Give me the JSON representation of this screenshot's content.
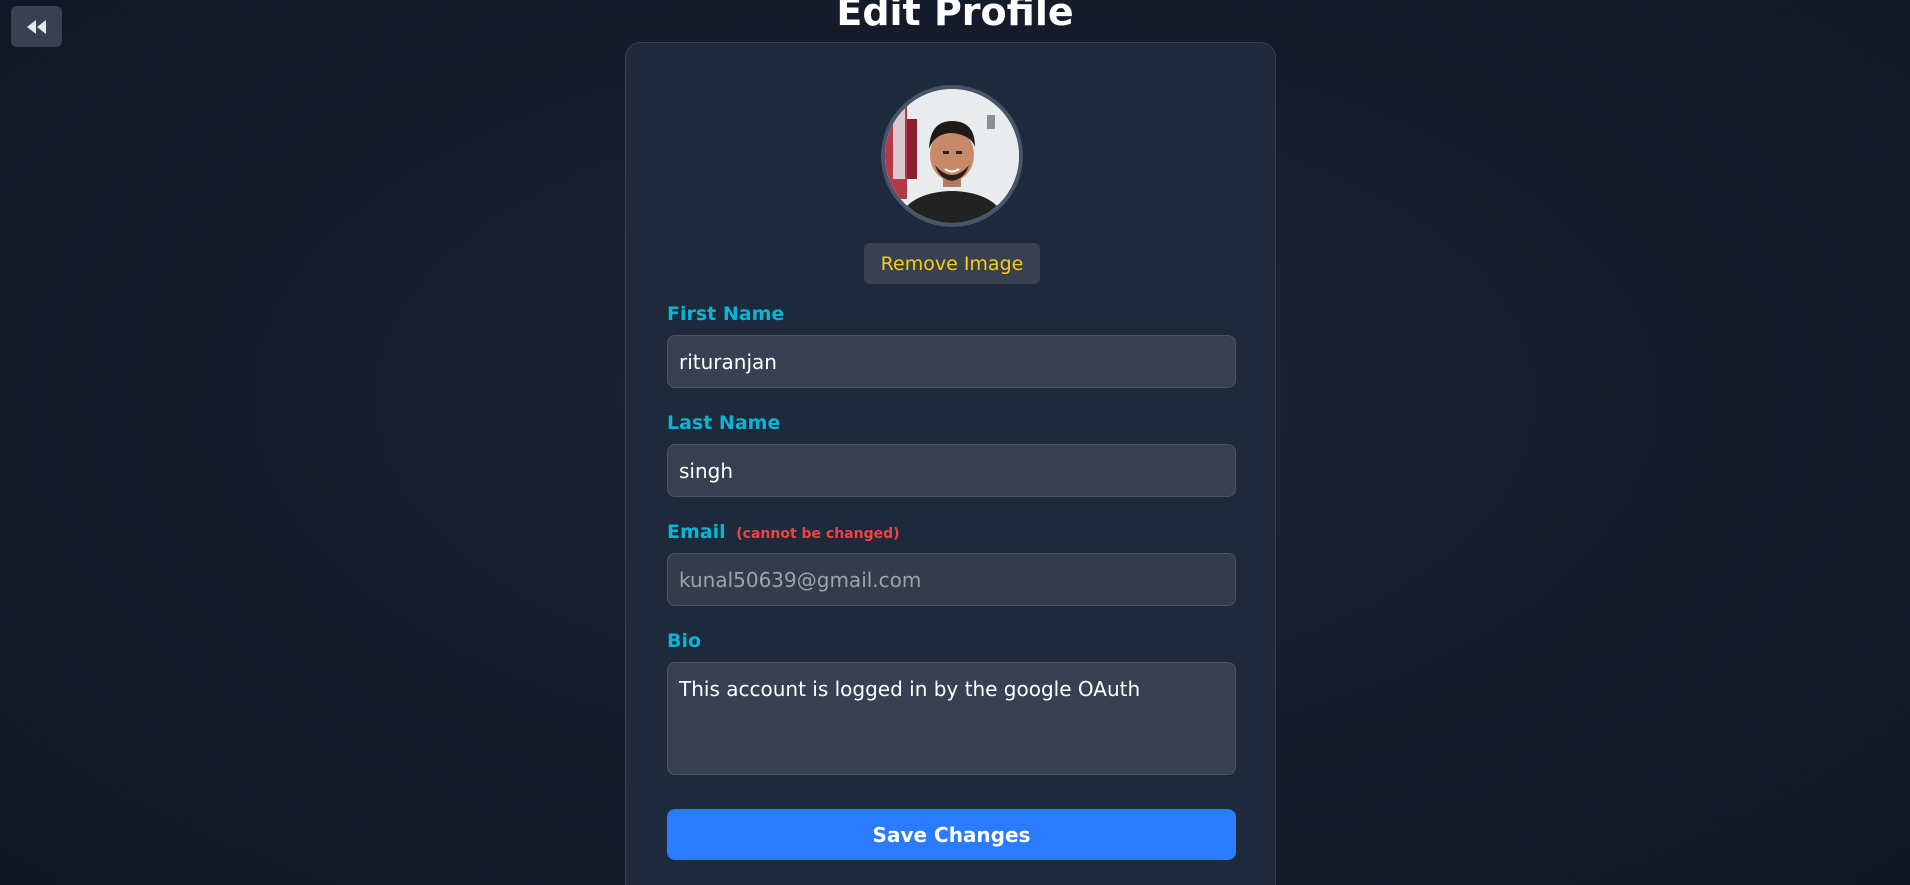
{
  "page": {
    "title": "Edit Profile"
  },
  "nav": {
    "back_icon": "double-chevron-left-icon"
  },
  "profile": {
    "avatar_alt": "profile photo",
    "remove_image_label": "Remove Image"
  },
  "form": {
    "first_name": {
      "label": "First Name",
      "value": "rituranjan"
    },
    "last_name": {
      "label": "Last Name",
      "value": "singh"
    },
    "email": {
      "label": "Email",
      "note": "(cannot be changed)",
      "value": "kunal50639@gmail.com"
    },
    "bio": {
      "label": "Bio",
      "value": "This account is logged in by the google OAuth"
    },
    "save_label": "Save Changes"
  },
  "colors": {
    "accent_label": "#06b6d4",
    "remove_text": "#facc15",
    "warning_note": "#ef4444",
    "primary_button": "#2b7bff"
  }
}
